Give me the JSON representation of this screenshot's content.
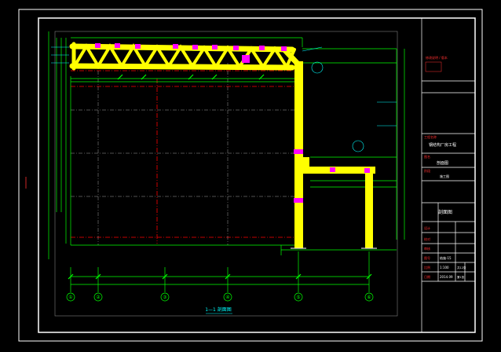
{
  "sheet_title": "1—1 剖面图",
  "axis_labels": [
    "①",
    "②",
    "③",
    "④",
    "⑤",
    "⑥"
  ],
  "title_block": {
    "revision_note": "修改说明 / 版本",
    "project_name": "钢结构厂房工程",
    "drawing_name": "剖面图",
    "drawing_number": "结施-15",
    "scale": "1:100",
    "date": "2014.09",
    "sheet_total": "共12张",
    "sheet_no": "第1张",
    "designer": "设计",
    "checker": "校对",
    "approver": "审核",
    "stage": "施工图",
    "field_labels": [
      "工程名称",
      "图名",
      "图号",
      "比例",
      "日期",
      "设计",
      "校对",
      "审核",
      "阶段"
    ]
  },
  "colors": {
    "background": "#000000",
    "frame": "#ffffff",
    "steel": "#ffff00",
    "dimension": "#00ff00",
    "centerline": "#ff0000",
    "joint": "#ff00ff",
    "annotation": "#00ffff",
    "title_red": "#ff3030"
  }
}
